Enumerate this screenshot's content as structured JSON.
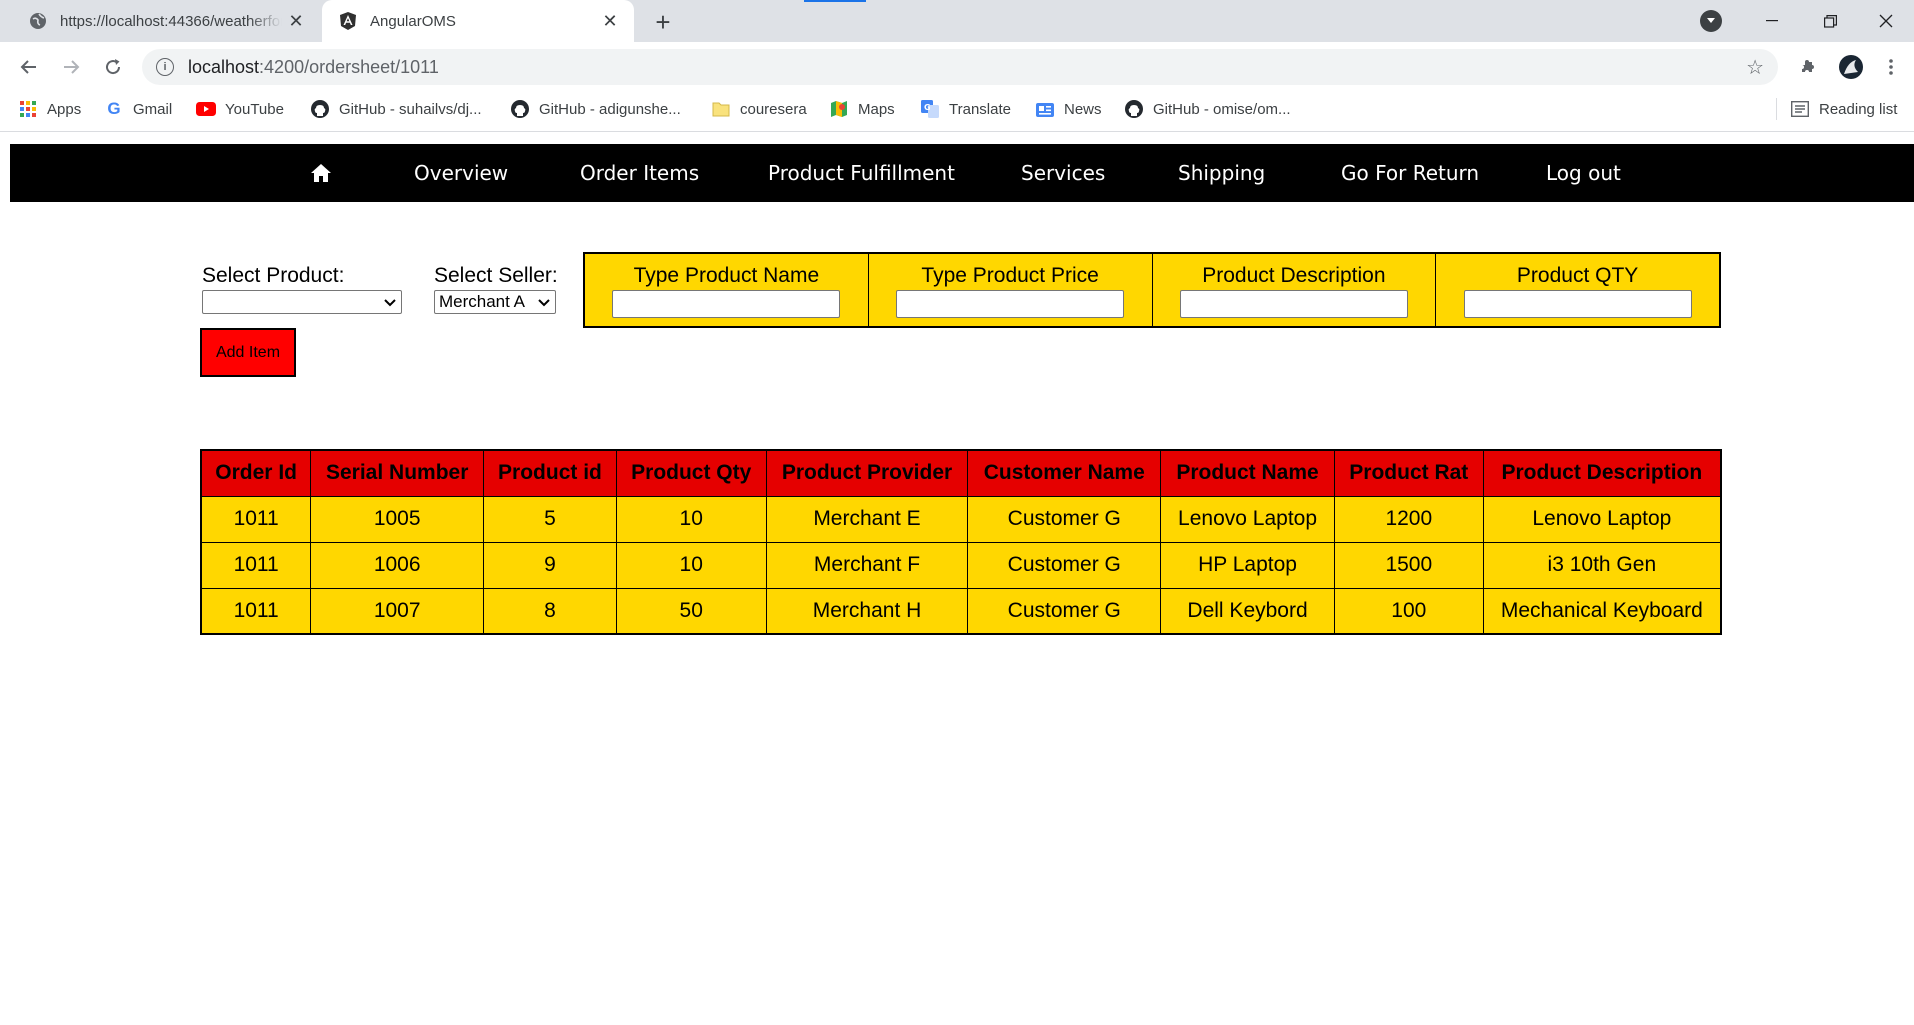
{
  "browser": {
    "tabs": [
      {
        "title": "https://localhost:44366/weatherforecast",
        "icon": "globe-icon",
        "active": false
      },
      {
        "title": "AngularOMS",
        "icon": "angular-icon",
        "active": true
      }
    ],
    "url_host": "localhost",
    "url_path": ":4200/ordersheet/1011",
    "bookmarks": [
      {
        "label": "Apps",
        "icon": "apps-grid-icon"
      },
      {
        "label": "Gmail",
        "icon": "google-icon"
      },
      {
        "label": "YouTube",
        "icon": "youtube-icon"
      },
      {
        "label": "GitHub - suhailvs/dj...",
        "icon": "github-icon"
      },
      {
        "label": "GitHub - adigunshe...",
        "icon": "github-icon"
      },
      {
        "label": "couresera",
        "icon": "folder-icon"
      },
      {
        "label": "Maps",
        "icon": "maps-icon"
      },
      {
        "label": "Translate",
        "icon": "translate-icon"
      },
      {
        "label": "News",
        "icon": "news-icon"
      },
      {
        "label": "GitHub - omise/om...",
        "icon": "github-icon"
      }
    ],
    "reading_list": "Reading list"
  },
  "navbar": {
    "home_icon": "home-icon",
    "items": [
      "Overview",
      "Order Items",
      "Product Fulfillment",
      "Services",
      "Shipping",
      "Go For Return",
      "Log out"
    ]
  },
  "form": {
    "select_product_label": "Select Product:",
    "select_product_value": "",
    "select_seller_label": "Select Seller:",
    "select_seller_value": "Merchant A",
    "fields": [
      {
        "label": "Type Product Name",
        "value": ""
      },
      {
        "label": "Type Product Price",
        "value": ""
      },
      {
        "label": "Product Description",
        "value": ""
      },
      {
        "label": "Product QTY",
        "value": ""
      }
    ],
    "add_button": "Add Item"
  },
  "table": {
    "headers": [
      "Order Id",
      "Serial Number",
      "Product id",
      "Product Qty",
      "Product Provider",
      "Customer Name",
      "Product Name",
      "Product Rat",
      "Product Description"
    ],
    "rows": [
      [
        "1011",
        "1005",
        "5",
        "10",
        "Merchant E",
        "Customer G",
        "Lenovo Laptop",
        "1200",
        "Lenovo Laptop"
      ],
      [
        "1011",
        "1006",
        "9",
        "10",
        "Merchant F",
        "Customer G",
        "HP Laptop",
        "1500",
        "i3 10th Gen"
      ],
      [
        "1011",
        "1007",
        "8",
        "50",
        "Merchant H",
        "Customer G",
        "Dell Keybord",
        "100",
        "Mechanical Keyboard"
      ]
    ]
  },
  "colors": {
    "navbar_bg": "#000000",
    "panel_yellow": "#ffd700",
    "header_red": "#e50000",
    "button_red": "#ff0000"
  }
}
